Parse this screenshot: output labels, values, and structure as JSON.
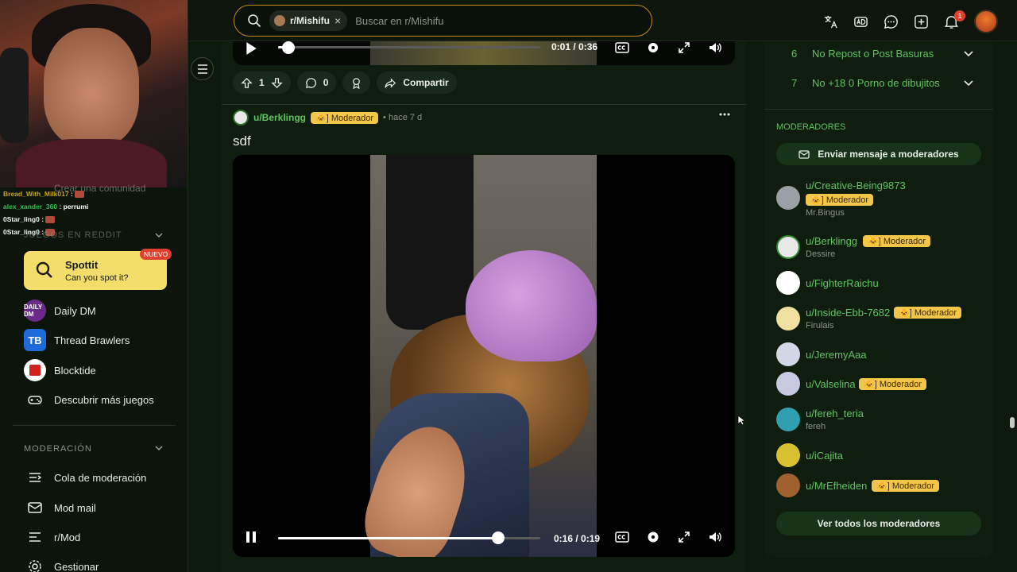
{
  "header": {
    "community_chip": "r/Mishifu",
    "search_placeholder": "Buscar en r/Mishifu",
    "notification_count": "1",
    "icons": [
      "translate-icon",
      "advertise-icon",
      "chat-icon",
      "create-icon",
      "bell-icon",
      "avatar"
    ]
  },
  "stream_chat": {
    "lines": [
      {
        "user": "Bread_With_Milk017",
        "msg": ""
      },
      {
        "user": "alex_xander_360",
        "msg": "perrumi"
      },
      {
        "user": "0Star_ling0",
        "msg": ""
      },
      {
        "user": "0Star_ling0",
        "msg": ""
      }
    ]
  },
  "sidebar": {
    "create_community": "Crear una comunidad",
    "games_section": "JUEGOS EN REDDIT",
    "spottit": {
      "title": "Spottit",
      "subtitle": "Can you spot it?",
      "badge": "NUEVO"
    },
    "games": [
      {
        "label": "Daily DM",
        "icon_text": "DAILY DM"
      },
      {
        "label": "Thread Brawlers",
        "icon_text": "TB"
      },
      {
        "label": "Blocktide",
        "icon_text": ""
      },
      {
        "label": "Descubrir más juegos"
      }
    ],
    "moderation_section": "MODERACIÓN",
    "moderation_items": [
      "Cola de moderación",
      "Mod mail",
      "r/Mod",
      "Gestionar"
    ]
  },
  "prev_post": {
    "time": "0:01 / 0:36",
    "progress": 0.04,
    "votes": "1",
    "comments": "0",
    "share": "Compartir"
  },
  "post": {
    "author": "u/Berklingg",
    "flair": "Moderador",
    "age": "hace 7 d",
    "title": "sdf",
    "time": "0:16 / 0:19",
    "progress": 0.84
  },
  "rules": [
    {
      "num": "6",
      "text": "No Repost o Post Basuras"
    },
    {
      "num": "7",
      "text": "No +18 0 Porno de dibujitos"
    }
  ],
  "moderators": {
    "title": "MODERADORES",
    "message_button": "Enviar mensaje a moderadores",
    "view_all": "Ver todos los moderadores",
    "list": [
      {
        "name": "u/Creative-Being9873",
        "flair": "Moderador",
        "sub": "Mr.Bingus",
        "color": "#9aa0a6"
      },
      {
        "name": "u/Berklingg",
        "flair": "Moderador",
        "sub": "Dessire",
        "color": "#e8e8e8"
      },
      {
        "name": "u/FighterRaichu",
        "flair": "",
        "sub": "",
        "color": "#ffffff"
      },
      {
        "name": "u/Inside-Ebb-7682",
        "flair": "Moderador",
        "sub": "Firulais",
        "color": "#f0e0a0"
      },
      {
        "name": "u/JeremyAaa",
        "flair": "",
        "sub": "",
        "color": "#d0d8e8"
      },
      {
        "name": "u/Valselina",
        "flair": "Moderador",
        "sub": "",
        "color": "#c8c8e0"
      },
      {
        "name": "u/fereh_teria",
        "flair": "",
        "sub": "fereh",
        "color": "#30a0b0"
      },
      {
        "name": "u/iCajita",
        "flair": "",
        "sub": "",
        "color": "#d8c030"
      },
      {
        "name": "u/MrEfheiden",
        "flair": "Moderador",
        "sub": "",
        "color": "#a06030"
      }
    ]
  },
  "colors": {
    "accent": "#5fc45f",
    "flair": "#f3c64a",
    "search_border": "#c58a1c"
  }
}
